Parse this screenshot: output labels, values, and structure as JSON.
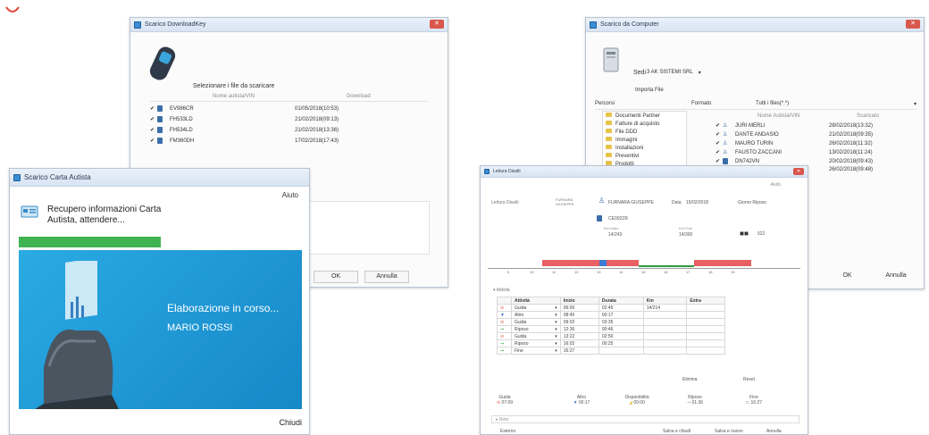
{
  "w1": {
    "title": "Scarico DownloadKey",
    "select_label": "Selezionare i file da scaricare",
    "col_name": "Nome autista/VIN",
    "col_download": "Download",
    "files": [
      {
        "name": "EV986CR",
        "date": "01/05/2018(10:53)"
      },
      {
        "name": "FH533LD",
        "date": "21/02/2018(09:13)"
      },
      {
        "name": "FH534LD",
        "date": "21/02/2018(13:36)"
      },
      {
        "name": "FM360DH",
        "date": "17/02/2018(17:43)"
      }
    ],
    "ok": "OK",
    "cancel": "Annulla"
  },
  "w2": {
    "title": "Scarico da Computer",
    "sedi_label": "Sedi",
    "sedi_value": "3 AK SISTEMI SRL",
    "import_label": "Importa File",
    "percorsi": "Percorsi",
    "formato": "Formato",
    "formato_value": "Tutti i files(*.*)",
    "folders": [
      "Documenti Partner",
      "Fatture di acquisto",
      "File DDD",
      "Immagini",
      "Installazioni",
      "Preventivi",
      "Prodotti"
    ],
    "col_name": "Nome Autista/VIN",
    "col_date": "Scaricato",
    "files": [
      {
        "name": "JURI MERLI",
        "date": "28/02/2018(13:32)"
      },
      {
        "name": "DANTE ANDASIO",
        "date": "21/02/2018(09:35)"
      },
      {
        "name": "MAURO TURIN",
        "date": "26/02/2018(11:32)"
      },
      {
        "name": "FAUSTO ZACCANI",
        "date": "13/02/2018(11:24)"
      },
      {
        "name": "DN742VN",
        "date": "20/02/2018(09:43)"
      },
      {
        "name": "",
        "date": "26/02/2018(09:48)"
      }
    ],
    "ok": "OK",
    "cancel": "Annulla"
  },
  "w3": {
    "title": "Scarico Carta Autista",
    "help": "Aiuto",
    "status": "Recupero informazioni Carta Autista, attendere...",
    "progress": 0.5,
    "banner_text": "Elaborazione in corso...",
    "driver": "MARIO ROSSI",
    "close": "Chiudi"
  },
  "w4": {
    "title": "Lettura Disalti",
    "help": "Aiuto",
    "header": {
      "left": "Lettura Disalti",
      "name_small": "FURNARA GIUSEPPE",
      "driver": "FURNARA GIUSEPPE",
      "date_label": "Data",
      "date": "15/02/2018",
      "day_state": "Giorno Riposo",
      "vehicle": "CE002ZR",
      "from_label": "Km Inizio",
      "from_val": "14/243",
      "km_label": "Km",
      "to_label": "Km Fine",
      "to_val": "14/300",
      "distance": "522"
    },
    "axis_ticks": [
      "9",
      "10",
      "11",
      "12",
      "13",
      "14",
      "15",
      "16",
      "17",
      "18",
      "19"
    ],
    "section": "Attività",
    "table": {
      "headers": [
        "",
        "Attività",
        "Inizio",
        "Durata",
        "Km",
        "Extra"
      ],
      "rows": [
        {
          "icon": "guida",
          "act": "Guida",
          "start": "06:00",
          "dur": "02:45",
          "km": "14/214",
          "extra": ""
        },
        {
          "icon": "altro",
          "act": "Altro",
          "start": "08:45",
          "dur": "00:17",
          "km": "",
          "extra": ""
        },
        {
          "icon": "guida",
          "act": "Guida",
          "start": "09:02",
          "dur": "03:35",
          "km": "",
          "extra": ""
        },
        {
          "icon": "riposo",
          "act": "Riposo",
          "start": "12:36",
          "dur": "00:46",
          "km": "",
          "extra": ""
        },
        {
          "icon": "guida",
          "act": "Guida",
          "start": "13:22",
          "dur": "02:50",
          "km": "",
          "extra": ""
        },
        {
          "icon": "riposo",
          "act": "Riposo",
          "start": "16:02",
          "dur": "00:25",
          "km": "",
          "extra": ""
        },
        {
          "icon": "riposo",
          "act": "Fine",
          "start": "16:27",
          "dur": "",
          "km": "",
          "extra": ""
        }
      ]
    },
    "btn_elimina": "Elimina",
    "btn_reset": "Reset",
    "summary": [
      {
        "label": "Guida",
        "value": "07:09"
      },
      {
        "label": "Altro",
        "value": "00:17"
      },
      {
        "label": "Disponibilità",
        "value": "00:00"
      },
      {
        "label": "Riposo",
        "value": "01:36"
      },
      {
        "label": "Fine",
        "value": "16:27"
      }
    ],
    "notes_label": "Note",
    "footer_left": "Esterno",
    "btn_save_exit": "Salva e chiudi",
    "btn_save_new": "Salva e nuovo",
    "btn_cancel": "Annulla"
  },
  "colors": {
    "accent": "#1e9bd6",
    "progress": "#3fb34f",
    "guida": "#e85f64",
    "riposo": "#2e9c44",
    "altro": "#3a7bd5"
  }
}
